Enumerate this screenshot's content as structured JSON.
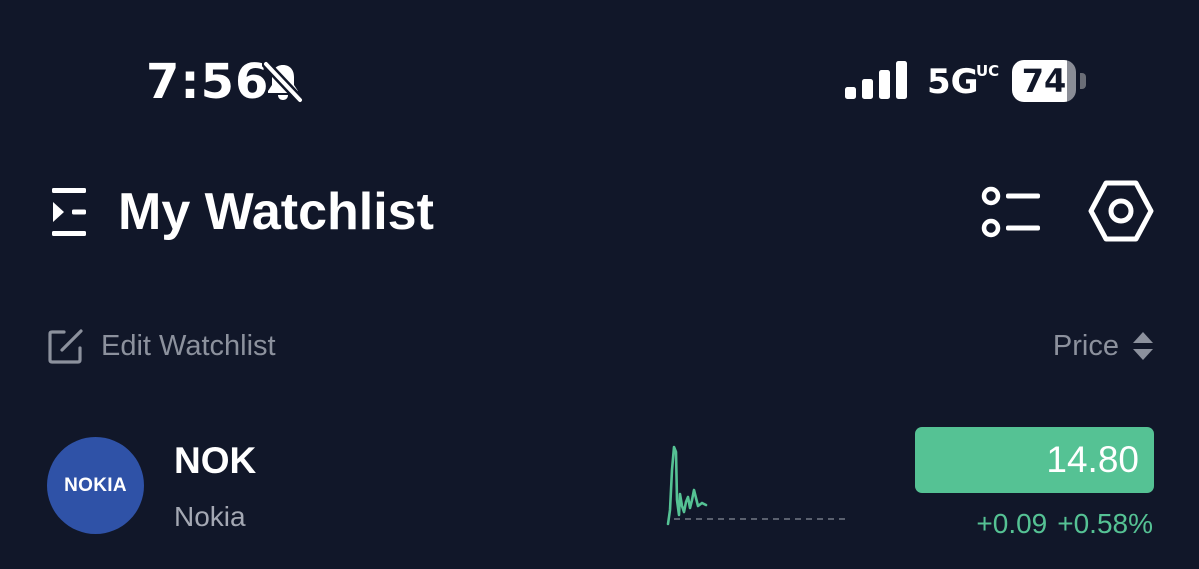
{
  "status_bar": {
    "time": "7:56",
    "network": "5G",
    "network_sup": "UC",
    "battery_level": "74",
    "icons": [
      "bell-slash-icon",
      "cellular-signal-icon",
      "battery-icon"
    ]
  },
  "header": {
    "title": "My Watchlist",
    "icons": [
      "sidebar-toggle-icon",
      "list-view-icon",
      "settings-icon"
    ]
  },
  "toolbar": {
    "edit_label": "Edit Watchlist",
    "sort_label": "Price",
    "icons": [
      "edit-icon",
      "sort-icon"
    ]
  },
  "stocks": [
    {
      "logo_text": "NOKIA",
      "symbol": "NOK",
      "name": "Nokia",
      "price": "14.80",
      "change": "+0.09",
      "change_percent": "+0.58%",
      "trend": "up"
    }
  ],
  "colors": {
    "background": "#111729",
    "accent_green": "#55c294",
    "muted_text": "#8c919d",
    "nokia_blue": "#2f52a7"
  }
}
